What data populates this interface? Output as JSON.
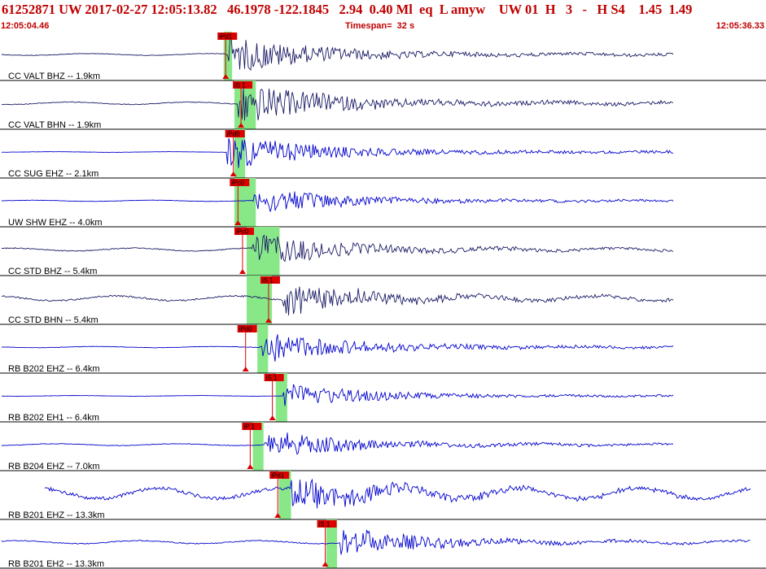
{
  "header": {
    "event_id": "61252871",
    "network": "UW",
    "date": "2017-02-27",
    "time": "12:05:13.82",
    "lat": "46.1978",
    "lon": "-122.1845",
    "depth": "2.94",
    "magnitude": "0.40",
    "mag_type": "Ml",
    "event_type": "eq",
    "flag": "L",
    "author": "amyw",
    "source": "UW",
    "version": "01",
    "quality": "H",
    "count": "3",
    "dash": "-",
    "solution": "H S4",
    "val1": "1.45",
    "val2": "1.49"
  },
  "timebar": {
    "start": "12:05:04.46",
    "span": "Timespan=  32 s",
    "end": "12:05:36.33"
  },
  "colors": {
    "header_text": "#c00000",
    "trace_dark": "#1a1a66",
    "trace_blue": "#0000cc",
    "pick_window": "#88e888",
    "pick_flag": "#dd0000",
    "divider": "#000000"
  },
  "channels": [
    {
      "label": "CC VALT BHZ -- 1.9km",
      "color": "dark",
      "onset": 0.294,
      "tail": 0.88,
      "amp": 0.55,
      "noise": 0.03,
      "pick": {
        "text": "iPd1",
        "x": 0.284,
        "win": [
          0.292,
          0.303
        ]
      }
    },
    {
      "label": "CC VALT BHN -- 1.9km",
      "color": "dark",
      "onset": 0.31,
      "tail": 0.88,
      "amp": 0.6,
      "noise": 0.04,
      "pick": {
        "text": "iS 1",
        "x": 0.304,
        "win": [
          0.306,
          0.334
        ]
      }
    },
    {
      "label": "CC SUG EHZ -- 2.1km",
      "color": "blue",
      "onset": 0.297,
      "tail": 0.88,
      "amp": 0.5,
      "noise": 0.01,
      "pick": {
        "text": "iPd0",
        "x": 0.294,
        "win": [
          0.306,
          0.32
        ]
      }
    },
    {
      "label": "UW SHW EHZ -- 4.0km",
      "color": "blue",
      "onset": 0.33,
      "tail": 0.88,
      "amp": 0.4,
      "noise": 0.02,
      "pick": {
        "text": "iPc0",
        "x": 0.3,
        "win": [
          0.306,
          0.334
        ]
      }
    },
    {
      "label": "CC STD BHZ -- 5.4km",
      "color": "dark",
      "onset": 0.33,
      "tail": 0.88,
      "amp": 0.45,
      "noise": 0.05,
      "pick": {
        "text": "iPc0",
        "x": 0.306,
        "win": [
          0.322,
          0.365
        ]
      }
    },
    {
      "label": "CC STD BHN -- 5.4km",
      "color": "dark",
      "onset": 0.37,
      "tail": 0.88,
      "amp": 0.45,
      "noise": 0.08,
      "pick": {
        "text": "iS 1",
        "x": 0.34,
        "win": [
          0.322,
          0.355
        ]
      }
    },
    {
      "label": "RB B202 EHZ -- 6.4km",
      "color": "blue",
      "onset": 0.34,
      "tail": 0.88,
      "amp": 0.45,
      "noise": 0.02,
      "pick": {
        "text": "iPd0",
        "x": 0.31,
        "win": [
          0.336,
          0.35
        ]
      }
    },
    {
      "label": "RB B202 EH1 -- 6.4km",
      "color": "blue",
      "onset": 0.37,
      "tail": 0.88,
      "amp": 0.35,
      "noise": 0.01,
      "pick": {
        "text": "iS 1",
        "x": 0.345,
        "win": [
          0.36,
          0.375
        ]
      }
    },
    {
      "label": "RB B204 EHZ -- 7.0km",
      "color": "blue",
      "onset": 0.345,
      "tail": 0.88,
      "amp": 0.4,
      "noise": 0.03,
      "pick": {
        "text": "iP 1",
        "x": 0.316,
        "win": [
          0.33,
          0.344
        ]
      }
    },
    {
      "label": "RB B201 EHZ -- 13.3km",
      "color": "blue",
      "onset": 0.38,
      "tail": 0.98,
      "amp": 0.45,
      "noise": 0.18,
      "pick": {
        "text": "iPd1",
        "x": 0.352,
        "win": [
          0.364,
          0.38
        ]
      }
    },
    {
      "label": "RB B201 EH2 -- 13.3km",
      "color": "blue",
      "onset": 0.445,
      "tail": 0.98,
      "amp": 0.4,
      "noise": 0.05,
      "pick": {
        "text": "iS 1",
        "x": 0.414,
        "win": [
          0.426,
          0.44
        ]
      }
    }
  ]
}
